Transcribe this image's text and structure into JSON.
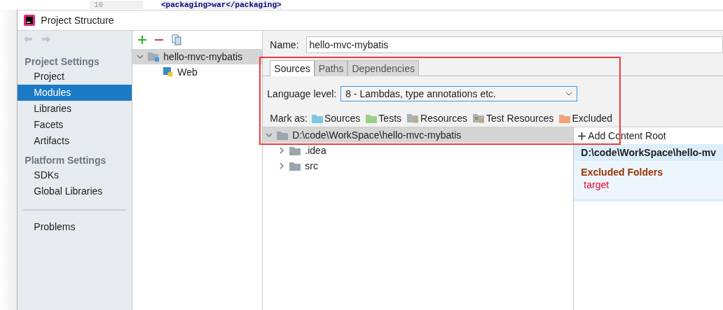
{
  "editor": {
    "line_number": "10",
    "code": "<packaging>war</packaging>"
  },
  "window": {
    "title": "Project Structure"
  },
  "sidebar": {
    "sections": [
      {
        "title": "Project Settings",
        "items": [
          {
            "label": "Project",
            "selected": false
          },
          {
            "label": "Modules",
            "selected": true
          },
          {
            "label": "Libraries",
            "selected": false
          },
          {
            "label": "Facets",
            "selected": false
          },
          {
            "label": "Artifacts",
            "selected": false
          }
        ]
      },
      {
        "title": "Platform Settings",
        "items": [
          {
            "label": "SDKs",
            "selected": false
          },
          {
            "label": "Global Libraries",
            "selected": false
          }
        ]
      }
    ],
    "footer_items": [
      {
        "label": "Problems",
        "selected": false
      }
    ]
  },
  "module_tree": {
    "items": [
      {
        "label": "hello-mvc-mybatis",
        "selected": true,
        "expanded": true,
        "children": [
          {
            "label": "Web",
            "selected": false
          }
        ]
      }
    ]
  },
  "name_field": {
    "label": "Name:",
    "value": "hello-mvc-mybatis"
  },
  "tabs": [
    {
      "label": "Sources",
      "selected": true
    },
    {
      "label": "Paths",
      "selected": false
    },
    {
      "label": "Dependencies",
      "selected": false
    }
  ],
  "language_level": {
    "label": "Language level:",
    "value": "8 - Lambdas, type annotations etc."
  },
  "mark_as": {
    "label": "Mark as:",
    "options": [
      {
        "label": "Sources",
        "kind": "folder",
        "color": "#7ec8e6"
      },
      {
        "label": "Tests",
        "kind": "folder",
        "color": "#9ccf87"
      },
      {
        "label": "Resources",
        "kind": "resource",
        "color": "#aab2ba"
      },
      {
        "label": "Test Resources",
        "kind": "test-resource",
        "color": "#aab2ba"
      },
      {
        "label": "Excluded",
        "kind": "folder",
        "color": "#f2a27a"
      }
    ]
  },
  "content_tree": {
    "items": [
      {
        "label": "D:\\code\\WorkSpace\\hello-mvc-mybatis",
        "selected": true,
        "expanded": true,
        "children": [
          {
            "label": ".idea",
            "selected": false,
            "expanded": false
          },
          {
            "label": "src",
            "selected": false,
            "expanded": false
          }
        ]
      }
    ]
  },
  "content_root_panel": {
    "add_button": "Add Content Root",
    "root_path": "D:\\code\\WorkSpace\\hello-mv",
    "excluded_title": "Excluded Folders",
    "excluded": [
      "target"
    ]
  }
}
